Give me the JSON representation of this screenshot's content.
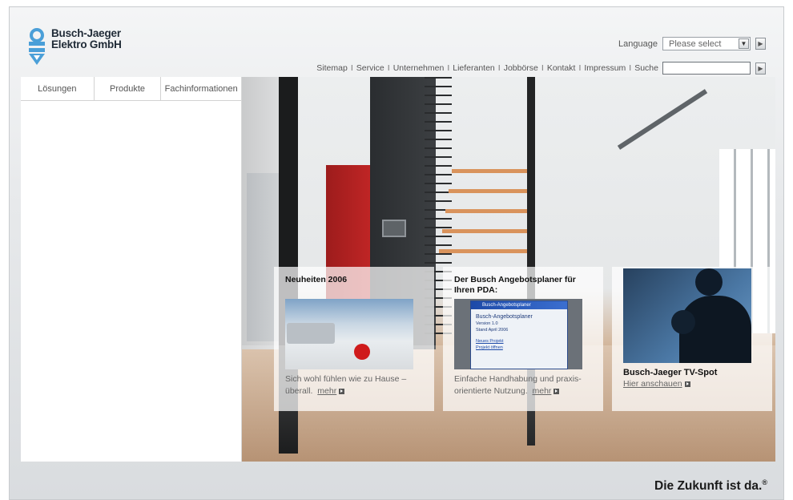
{
  "brand": {
    "name_line1": "Busch-Jaeger",
    "name_line2": "Elektro GmbH",
    "logo_color": "#4a9fd8"
  },
  "language": {
    "label": "Language",
    "selected": "Please select"
  },
  "topnav": {
    "links": [
      "Sitemap",
      "Service",
      "Unternehmen",
      "Lieferanten",
      "Jobbörse",
      "Kontakt",
      "Impressum",
      "Suche"
    ],
    "separator": "I",
    "search_value": ""
  },
  "left_tabs": [
    "Lösungen",
    "Produkte",
    "Fachinformationen"
  ],
  "boxes": [
    {
      "title": "Neuheiten 2006",
      "text_line1": "Sich wohl fühlen wie zu Hause –",
      "text_line2": "überall.",
      "more": "mehr"
    },
    {
      "title": "Der Busch Angebotsplaner für Ihren PDA:",
      "text_line1": "Einfache Handhabung und praxis-",
      "text_line2": "orientierte Nutzung.",
      "more": "mehr",
      "pda": {
        "titlebar": "Busch-Angebotsplaner",
        "heading": "Busch-Angebotsplaner",
        "version": "Version 1.0",
        "date": "Stand April 2006",
        "link1": "Neues Projekt",
        "link2": "Projekt öffnen"
      }
    },
    {
      "title": "Busch-Jaeger TV-Spot",
      "link": "Hier anschauen"
    }
  ],
  "footer": {
    "slogan": "Die Zukunft ist da.",
    "mark": "®"
  }
}
